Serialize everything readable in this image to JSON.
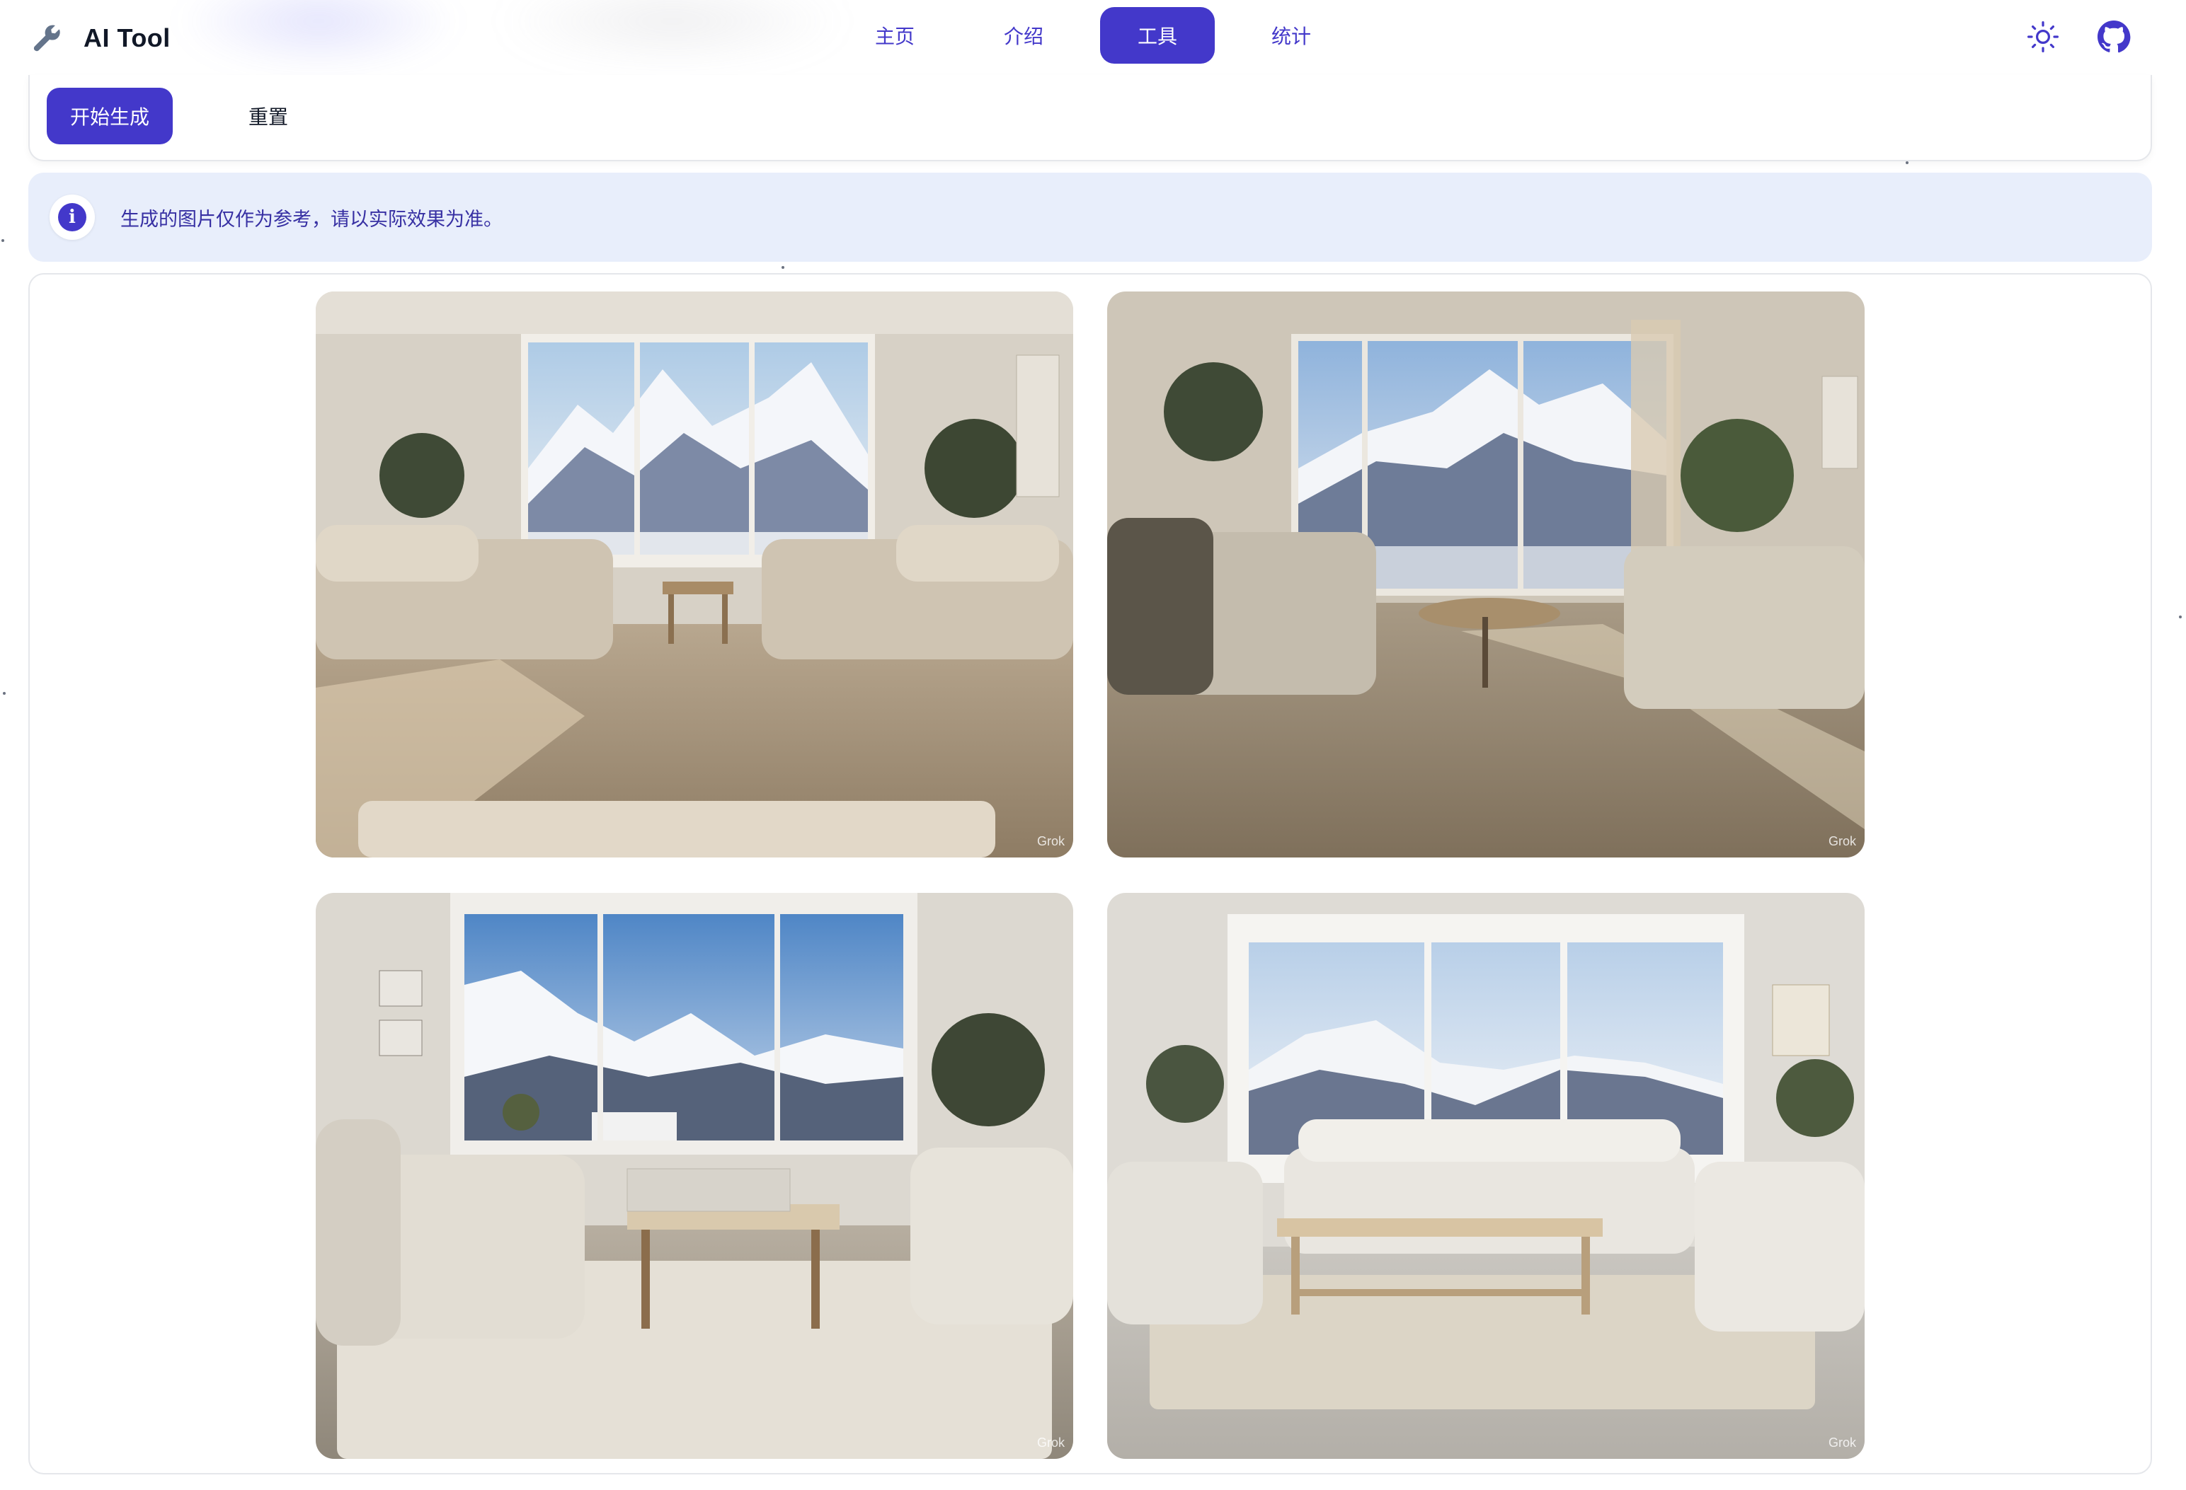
{
  "header": {
    "brand_title": "AI Tool",
    "brand_icon": "wrench-icon",
    "nav": [
      {
        "label": "主页",
        "active": false
      },
      {
        "label": "介绍",
        "active": false
      },
      {
        "label": "工具",
        "active": true
      },
      {
        "label": "统计",
        "active": false
      }
    ],
    "icons": [
      "sun-icon",
      "github-icon"
    ]
  },
  "actions": {
    "generate_label": "开始生成",
    "reset_label": "重置"
  },
  "notice": {
    "icon": "info-icon",
    "text": "生成的图片仅作为参考，请以实际效果为准。"
  },
  "gallery": {
    "images": [
      {
        "description": "Living room with two beige sofas, wooden coffee table and mountain view window",
        "watermark": "Grok"
      },
      {
        "description": "Living room with sofas, round coffee table, plants and mountain view",
        "watermark": "Grok"
      },
      {
        "description": "Living room with white sofas, rug, coffee table and snowy mountain view",
        "watermark": "Grok"
      },
      {
        "description": "Bright living room with three sofas, long coffee table and mountain view",
        "watermark": "Grok"
      }
    ]
  },
  "colors": {
    "primary": "#4338ca",
    "notice_bg": "#e8eefb",
    "notice_text": "#3730a3"
  }
}
